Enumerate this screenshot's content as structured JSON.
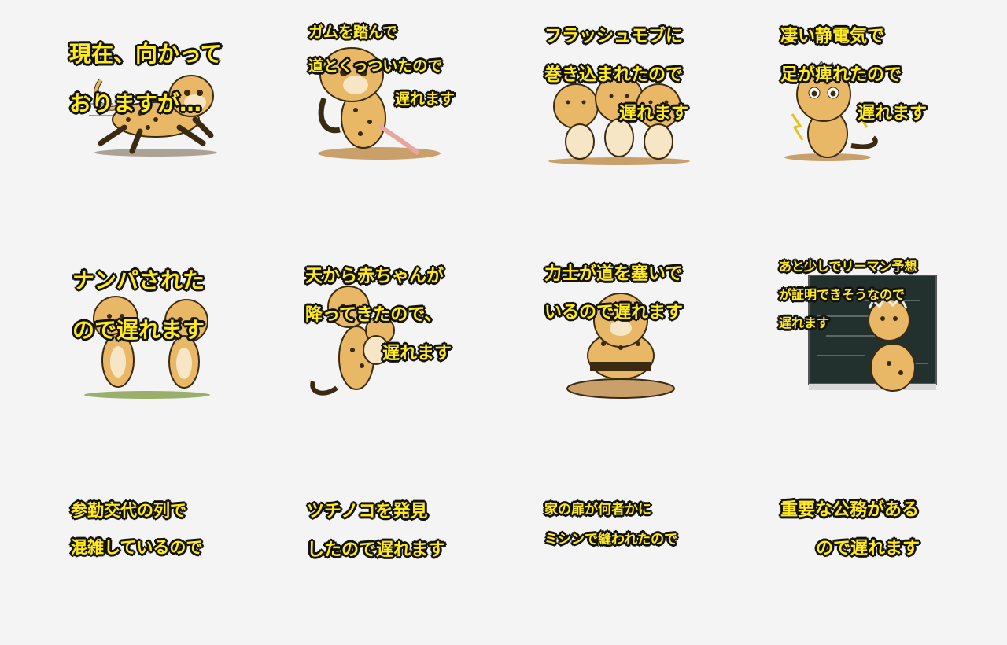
{
  "stickers": [
    {
      "lines": [
        "現在、向かって",
        "おりますが…"
      ]
    },
    {
      "lines": [
        "ガムを踏んで",
        "道とくっついたので",
        "遅れます"
      ]
    },
    {
      "lines": [
        "フラッシュモブに",
        "巻き込まれたので",
        "遅れます"
      ]
    },
    {
      "lines": [
        "凄い静電気で",
        "足が痺れたので",
        "遅れます"
      ]
    },
    {
      "lines": [
        "ナンパされた",
        "ので遅れます"
      ]
    },
    {
      "lines": [
        "天から赤ちゃんが",
        "降ってきたので、",
        "遅れます"
      ]
    },
    {
      "lines": [
        "力士が道を塞いで",
        "いるので遅れます"
      ]
    },
    {
      "lines": [
        "あと少しでリーマン予想",
        "が証明できそうなので",
        "遅れます"
      ]
    },
    {
      "lines": [
        "参勤交代の列で",
        "混雑しているので"
      ]
    },
    {
      "lines": [
        "ツチノコを発見",
        "したので遅れます"
      ]
    },
    {
      "lines": [
        "家の扉が何者かに",
        "ミシンで縫われたので"
      ]
    },
    {
      "lines": [
        "重要な公務がある",
        "ので遅れます"
      ]
    }
  ],
  "colors": {
    "background": "#f4f4f5",
    "caption_fill": "#ffe91f",
    "caption_outline": "#111111",
    "cheetah_fur": "#e8b866",
    "cheetah_light": "#f7e6c5",
    "spots": "#3a2a12",
    "ground": "#c9a06a",
    "chalkboard": "#22302e"
  }
}
